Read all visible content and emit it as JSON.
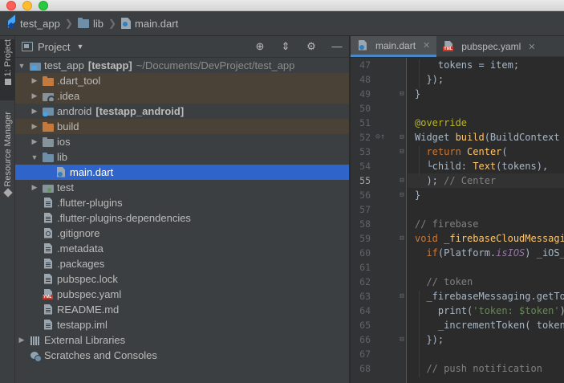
{
  "window": {
    "title": ""
  },
  "breadcrumb": [
    {
      "label": "test_app",
      "icon": "flutter-icon"
    },
    {
      "label": "lib",
      "icon": "folder-icon"
    },
    {
      "label": "main.dart",
      "icon": "dart-file-icon"
    }
  ],
  "stripe": {
    "project_tab": "1: Project",
    "resource_tab": "Resource Manager"
  },
  "project_panel": {
    "title": "Project",
    "tools": [
      "target-icon",
      "collapse-icon",
      "gear-icon",
      "minimize-icon"
    ]
  },
  "tree": {
    "root": {
      "name": "test_app",
      "module": "[testapp]",
      "path": "~/Documents/DevProject/test_app"
    },
    "items": [
      {
        "label": ".dart_tool",
        "module": ""
      },
      {
        "label": ".idea",
        "module": ""
      },
      {
        "label": "android",
        "module": "[testapp_android]"
      },
      {
        "label": "build",
        "module": ""
      },
      {
        "label": "ios",
        "module": ""
      },
      {
        "label": "lib",
        "module": ""
      },
      {
        "label": "main.dart",
        "module": ""
      },
      {
        "label": "test",
        "module": ""
      },
      {
        "label": ".flutter-plugins",
        "module": ""
      },
      {
        "label": ".flutter-plugins-dependencies",
        "module": ""
      },
      {
        "label": ".gitignore",
        "module": ""
      },
      {
        "label": ".metadata",
        "module": ""
      },
      {
        "label": ".packages",
        "module": ""
      },
      {
        "label": "pubspec.lock",
        "module": ""
      },
      {
        "label": "pubspec.yaml",
        "module": ""
      },
      {
        "label": "README.md",
        "module": ""
      },
      {
        "label": "testapp.iml",
        "module": ""
      },
      {
        "label": "External Libraries",
        "module": ""
      },
      {
        "label": "Scratches and Consoles",
        "module": ""
      }
    ]
  },
  "editor": {
    "tabs": [
      {
        "label": "main.dart",
        "active": true
      },
      {
        "label": "pubspec.yaml",
        "active": false
      }
    ],
    "current_line": "55",
    "lines": [
      {
        "num": "47",
        "text": "    tokens = item;"
      },
      {
        "num": "48",
        "text": "  });"
      },
      {
        "num": "49",
        "text": "}"
      },
      {
        "num": "50",
        "text": ""
      },
      {
        "num": "51",
        "text": "@override"
      },
      {
        "num": "52",
        "text": "Widget build(BuildContext c"
      },
      {
        "num": "53",
        "text": "  return Center("
      },
      {
        "num": "54",
        "text": "    child: Text(tokens),"
      },
      {
        "num": "55",
        "text": "  ); // Center"
      },
      {
        "num": "56",
        "text": "}"
      },
      {
        "num": "57",
        "text": ""
      },
      {
        "num": "58",
        "text": "// firebase"
      },
      {
        "num": "59",
        "text": "void _firebaseCloudMessaging"
      },
      {
        "num": "60",
        "text": "  if(Platform.isIOS) _iOS_P"
      },
      {
        "num": "61",
        "text": ""
      },
      {
        "num": "62",
        "text": "  // token"
      },
      {
        "num": "63",
        "text": "  _firebaseMessaging.getTok"
      },
      {
        "num": "64",
        "text": "    print('token: $token');"
      },
      {
        "num": "65",
        "text": "    _incrementToken( token"
      },
      {
        "num": "66",
        "text": "  });"
      },
      {
        "num": "67",
        "text": ""
      },
      {
        "num": "68",
        "text": "  // push notification"
      }
    ]
  }
}
